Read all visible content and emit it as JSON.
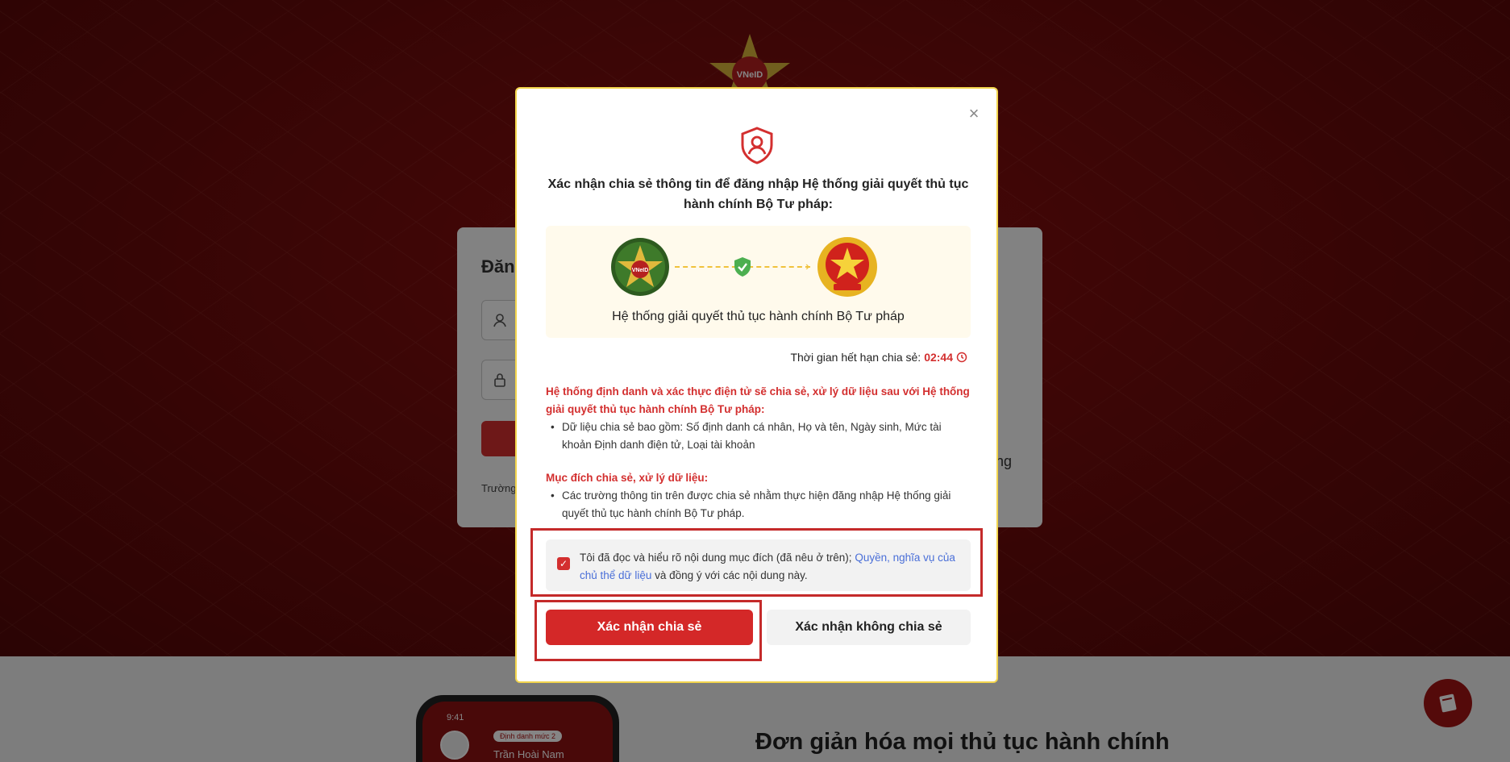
{
  "background": {
    "login_title": "Đăn",
    "footer_text": "Trường",
    "right_text": "ng",
    "phone": {
      "time": "9:41",
      "badge": "Định danh mức 2",
      "name": "Trần Hoài Nam"
    },
    "tagline": "Đơn giản hóa mọi thủ tục hành chính",
    "emblem_text": "VNeID"
  },
  "modal": {
    "close_label": "×",
    "title": "Xác nhận chia sẻ thông tin để đăng nhập Hệ thống giải quyết thủ tục hành chính Bộ Tư pháp:",
    "vneid_label": "VNeID",
    "share_target": "Hệ thống giải quyết thủ tục hành chính Bộ Tư pháp",
    "timer_label": "Thời gian hết hạn chia sẻ:",
    "timer_value": "02:44",
    "section1_head": "Hệ thống định danh và xác thực điện tử sẽ chia sẻ, xử lý dữ liệu sau với Hệ thống giải quyết thủ tục hành chính Bộ Tư pháp:",
    "section1_bullet": "Dữ liệu chia sẻ bao gồm: Số định danh cá nhân, Họ và tên, Ngày sinh, Mức tài khoản Định danh điện tử, Loại tài khoản",
    "section2_head": "Mục đích chia sẻ, xử lý dữ liệu:",
    "section2_bullet": "Các trường thông tin trên được chia sẻ nhằm thực hiện đăng nhập Hệ thống giải quyết thủ tục hành chính Bộ Tư pháp.",
    "consent_prefix": "Tôi đã đọc và hiểu rõ nội dung mục đích (đã nêu ở trên);",
    "consent_link": "Quyền, nghĩa vụ của chủ thể dữ liệu",
    "consent_suffix": "và đồng ý với các nội dung này.",
    "consent_checked": "✓",
    "confirm_button": "Xác nhận chia sẻ",
    "decline_button": "Xác nhận không chia sẻ"
  },
  "colors": {
    "brand_red": "#d42828",
    "link_blue": "#4a6fd8",
    "highlight_frame": "#c42a2a"
  }
}
